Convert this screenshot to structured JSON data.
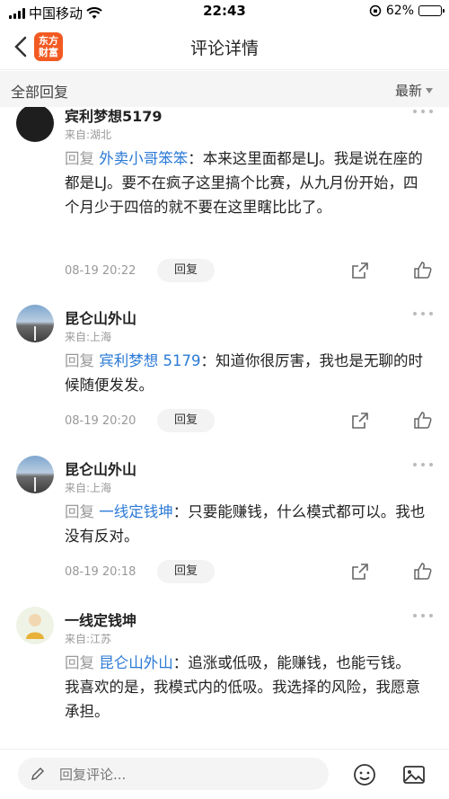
{
  "status_bar": {
    "carrier": "中国移动",
    "time": "22:43",
    "battery_percent": "62%",
    "battery_level": 0.62
  },
  "nav": {
    "title": "评论详情",
    "logo_line1": "东方",
    "logo_line2": "财富"
  },
  "filter": {
    "left_label": "全部回复",
    "sort_label": "最新"
  },
  "comments": [
    {
      "name": "宾利梦想5179",
      "location": "来自:湖北",
      "reply_prefix": "回复",
      "mention": "外卖小哥笨笨",
      "text": "：本来这里面都是LJ。我是说在座的都是LJ。要不在疯子这里搞个比赛，从九月份开始，四个月少于四倍的就不要在这里瞎比比了。",
      "time": "08-19 20:22",
      "reply_label": "回复"
    },
    {
      "name": "昆仑山外山",
      "location": "来自:上海",
      "reply_prefix": "回复",
      "mention": "宾利梦想 5179",
      "text": "：知道你很厉害，我也是无聊的时候随便发发。",
      "time": "08-19 20:20",
      "reply_label": "回复"
    },
    {
      "name": "昆仑山外山",
      "location": "来自:上海",
      "reply_prefix": "回复",
      "mention": "一线定钱坤",
      "text": "：只要能赚钱，什么模式都可以。我也没有反对。",
      "time": "08-19 20:18",
      "reply_label": "回复"
    },
    {
      "name": "一线定钱坤",
      "location": "来自:江苏",
      "reply_prefix": "回复",
      "mention": "昆仑山外山",
      "text": "：追涨或低吸，能赚钱，也能亏钱。",
      "text2": "我喜欢的是，我模式内的低吸。我选择的风险，我愿意承担。"
    }
  ],
  "bottom": {
    "input_placeholder": "回复评论..."
  }
}
